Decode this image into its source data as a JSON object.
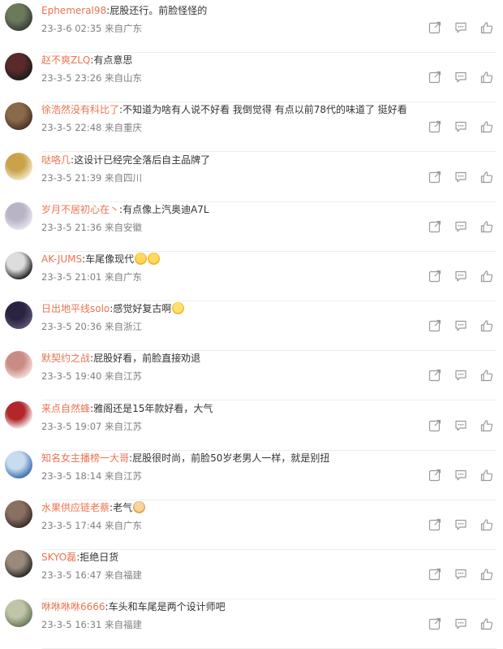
{
  "comments": [
    {
      "user": "Ephemeral98",
      "text": "屁股还行。前脸怪怪的",
      "time": "23-3-6 02:35",
      "location": "来自广东",
      "avatar_colors": [
        "#3a3d38",
        "#6a7a5a"
      ],
      "emojis": []
    },
    {
      "user": "赵不爽ZLQ",
      "text": "有点意思",
      "time": "23-3-5 23:26",
      "location": "来自山东",
      "avatar_colors": [
        "#1c1c1c",
        "#5a2a2a"
      ],
      "emojis": []
    },
    {
      "user": "徐浩然没有科比了",
      "text": "不知道为啥有人说不好看 我倒觉得 有点以前78代的味道了 挺好看",
      "time": "23-3-5 22:48",
      "location": "来自重庆",
      "avatar_colors": [
        "#4a3328",
        "#8a6a4a"
      ],
      "emojis": []
    },
    {
      "user": "哒咯几",
      "text": "这设计已经完全落后自主品牌了",
      "time": "23-3-5 21:39",
      "location": "来自四川",
      "avatar_colors": [
        "#f2e7c6",
        "#c9a24a"
      ],
      "emojis": []
    },
    {
      "user": "岁月不居初心在丶",
      "text": "有点像上汽奥迪A7L",
      "time": "23-3-5 21:36",
      "location": "来自安徽",
      "avatar_colors": [
        "#e8e4ee",
        "#b9b3c6"
      ],
      "emojis": []
    },
    {
      "user": "AK-JUMS",
      "text": "车尾像现代",
      "time": "23-3-5 21:01",
      "location": "来自广东",
      "avatar_colors": [
        "#222222",
        "#dddddd"
      ],
      "emojis": [
        "cry-laugh-emoji",
        "cry-laugh-emoji"
      ]
    },
    {
      "user": "日出地平线solo",
      "text": "感觉好复古啊",
      "time": "23-3-5 20:36",
      "location": "来自浙江",
      "avatar_colors": [
        "#5a5072",
        "#2a2440"
      ],
      "emojis": [
        "laugh-emoji"
      ]
    },
    {
      "user": "默契约之战",
      "text": "屁股好看，前脸直接劝退",
      "time": "23-3-5 19:40",
      "location": "来自江苏",
      "avatar_colors": [
        "#f2dcd8",
        "#c98c84"
      ],
      "emojis": []
    },
    {
      "user": "来点自然蜂",
      "text": "雅阁还是15年款好看，大气",
      "time": "23-3-5 19:07",
      "location": "来自江苏",
      "avatar_colors": [
        "#f4f4f4",
        "#b3262a"
      ],
      "emojis": []
    },
    {
      "user": "知名女主播榜一大哥",
      "text": "屁股很时尚，前脸50岁老男人一样，就是别扭",
      "time": "23-3-5 18:14",
      "location": "来自江苏",
      "avatar_colors": [
        "#3d6fb0",
        "#c8dcf0"
      ],
      "emojis": []
    },
    {
      "user": "水果供应链老蔡",
      "text": "老气",
      "time": "23-3-5 17:44",
      "location": "来自广东",
      "avatar_colors": [
        "#3a2e2a",
        "#8a7060"
      ],
      "emojis": [
        "doge-emoji"
      ]
    },
    {
      "user": "SKYO磊",
      "text": "拒绝日货",
      "time": "23-3-5 16:47",
      "location": "来自福建",
      "avatar_colors": [
        "#2b2b2b",
        "#9a8a7a"
      ],
      "emojis": []
    },
    {
      "user": "咻咻咻咻6666",
      "text": "车头和车尾是两个设计师吧",
      "time": "23-3-5 16:31",
      "location": "来自福建",
      "avatar_colors": [
        "#6a7a5a",
        "#c0c4a8"
      ],
      "emojis": []
    }
  ],
  "actions": [
    "share-icon",
    "reply-icon",
    "like-icon"
  ],
  "colors": {
    "username": "#eb7350",
    "text": "#333333",
    "meta": "#808080",
    "icon": "#9a9a9a"
  }
}
